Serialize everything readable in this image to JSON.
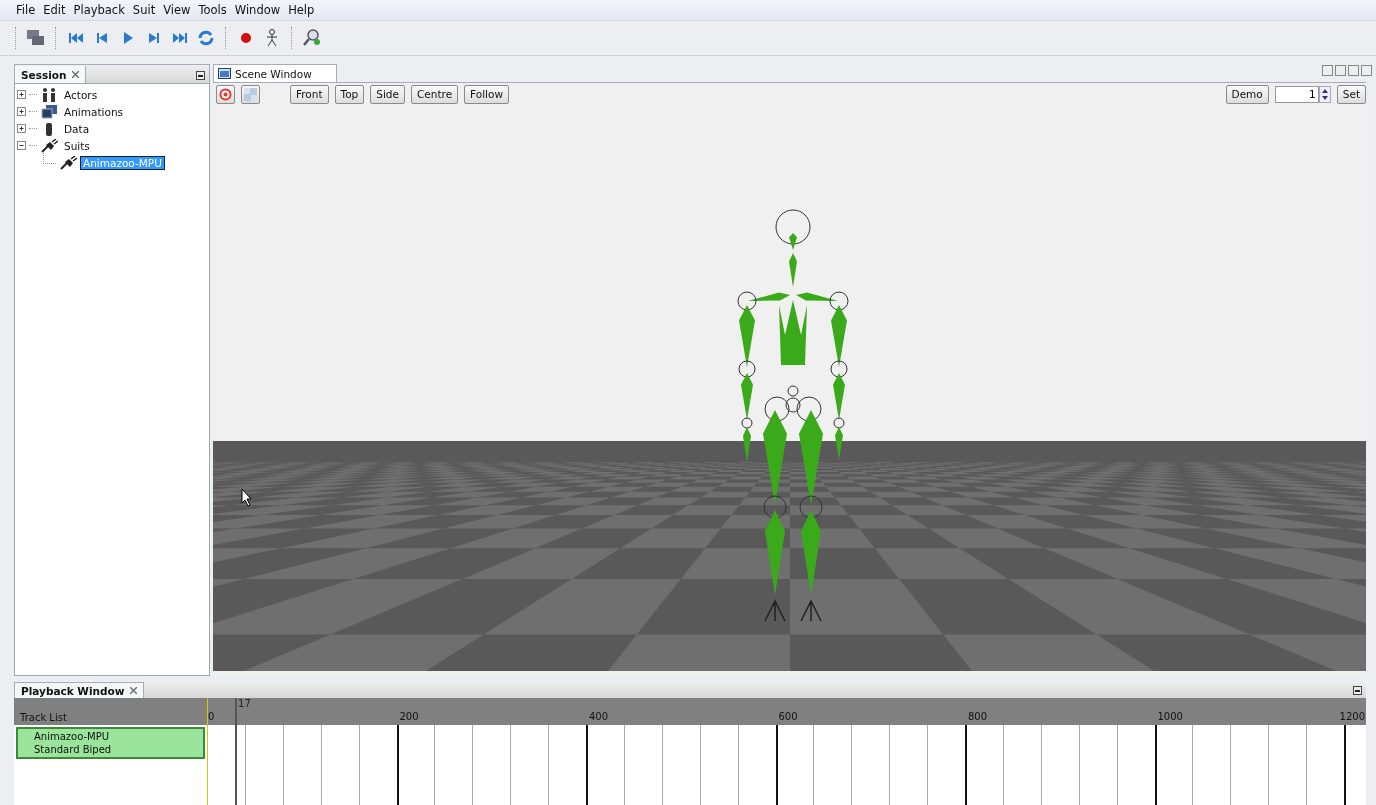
{
  "menu": [
    "File",
    "Edit",
    "Playback",
    "Suit",
    "View",
    "Tools",
    "Window",
    "Help"
  ],
  "session": {
    "title": "Session",
    "items": [
      {
        "label": "Actors",
        "expanded": false,
        "selected": false
      },
      {
        "label": "Animations",
        "expanded": false,
        "selected": false
      },
      {
        "label": "Data",
        "expanded": false,
        "selected": false
      },
      {
        "label": "Suits",
        "expanded": true,
        "selected": false,
        "children": [
          {
            "label": "Animazoo-MPU",
            "selected": true
          }
        ]
      }
    ]
  },
  "scene": {
    "tab": "Scene Window",
    "view_buttons": [
      "Front",
      "Top",
      "Side",
      "Centre",
      "Follow"
    ],
    "demo_button": "Demo",
    "frame_value": "1",
    "set_button": "Set"
  },
  "playback": {
    "tab": "Playback Window",
    "track_list_label": "Track List",
    "ruler": [
      "0",
      "200",
      "400",
      "600",
      "800",
      "1000",
      "1200"
    ],
    "playhead": "17",
    "tracks": [
      {
        "name": "Animazoo-MPU",
        "type": "Standard Biped",
        "selected": true
      }
    ]
  }
}
